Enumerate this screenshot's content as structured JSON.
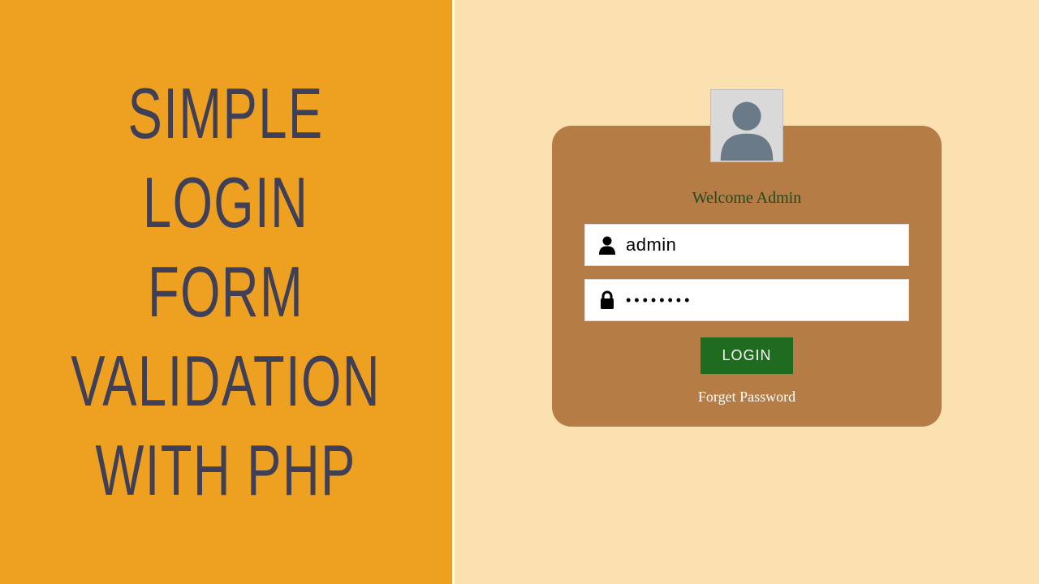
{
  "title": {
    "line1": "SIMPLE",
    "line2": "LOGIN",
    "line3": "FORM",
    "line4": "VALIDATION",
    "line5": "WITH PHP"
  },
  "card": {
    "welcome": "Welcome Admin",
    "username_value": "admin",
    "password_value": "••••••••",
    "login_label": "LOGIN",
    "forget_label": "Forget Password"
  },
  "colors": {
    "left_bg": "#eea020",
    "right_bg": "#fbe0b0",
    "card_bg": "#b57c46",
    "button_bg": "#1f6b1f",
    "title_color": "#3f3f58"
  }
}
